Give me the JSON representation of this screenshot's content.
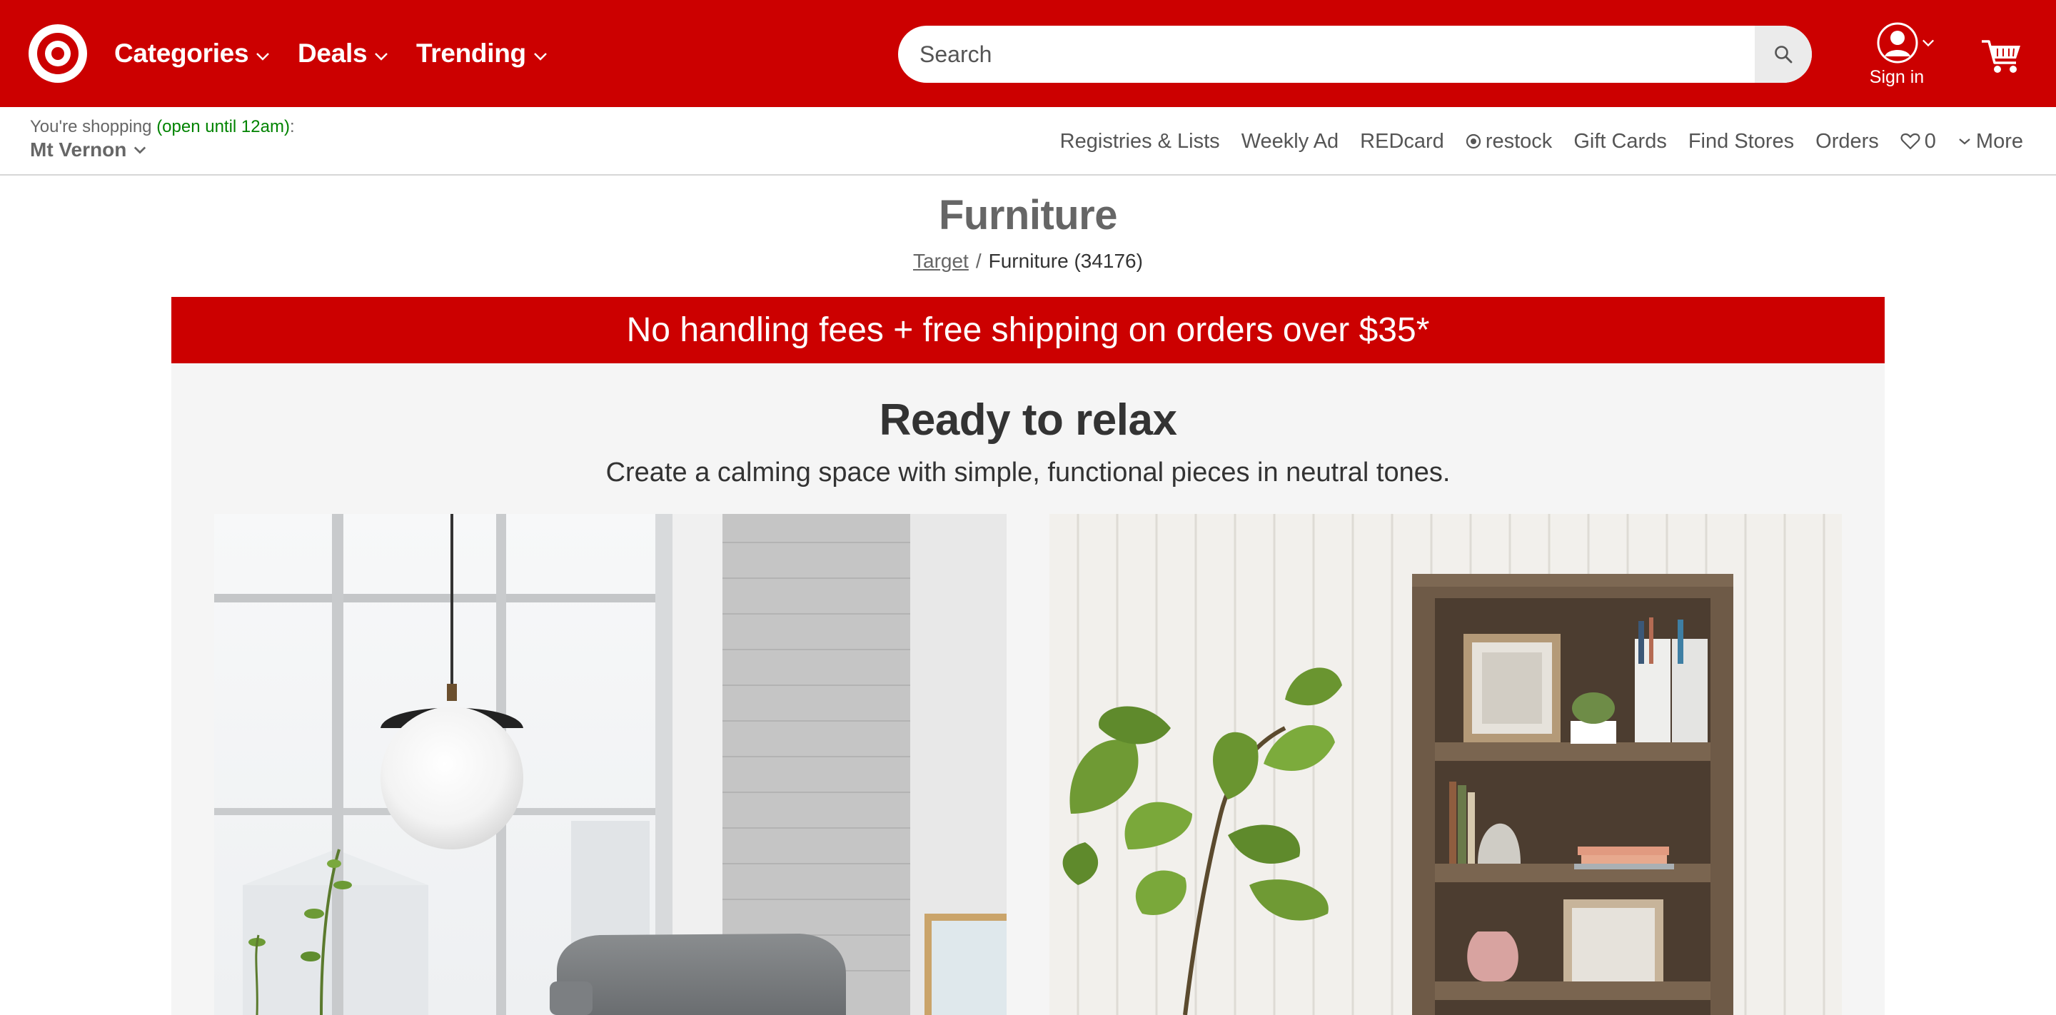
{
  "header": {
    "nav": [
      {
        "label": "Categories"
      },
      {
        "label": "Deals"
      },
      {
        "label": "Trending"
      }
    ],
    "search": {
      "placeholder": "Search",
      "value": ""
    },
    "signin_label": "Sign in"
  },
  "utility": {
    "shopping_prefix": "You're shopping ",
    "store_hours": "(open until 12am)",
    "shopping_suffix": ":",
    "store_name": "Mt Vernon",
    "links": {
      "registries": "Registries & Lists",
      "weekly_ad": "Weekly Ad",
      "redcard": "REDcard",
      "restock": "restock",
      "gift_cards": "Gift Cards",
      "find_stores": "Find Stores",
      "orders": "Orders",
      "favorites_count": "0",
      "more": "More"
    }
  },
  "page": {
    "title": "Furniture",
    "breadcrumb_root": "Target",
    "breadcrumb_separator": "/",
    "breadcrumb_current": "Furniture (34176)"
  },
  "promo": {
    "text": "No handling fees + free shipping on orders over $35*"
  },
  "feature": {
    "title": "Ready to relax",
    "subtitle": "Create a calming space with simple, functional pieces in neutral tones."
  },
  "colors": {
    "brand_red": "#cc0000",
    "open_green": "#008300",
    "panel_gray": "#f5f5f5"
  },
  "icons": [
    "target-logo-icon",
    "chevron-down-icon",
    "search-icon",
    "user-icon",
    "cart-icon",
    "restock-icon",
    "heart-icon"
  ]
}
